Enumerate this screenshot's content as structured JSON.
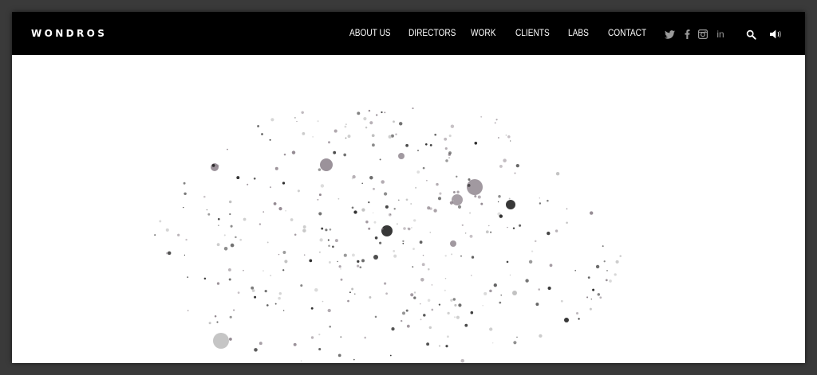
{
  "brand": {
    "name": "WONDROS"
  },
  "nav": {
    "items": [
      {
        "label": "ABOUT US"
      },
      {
        "label": "DIRECTORS"
      },
      {
        "label": "WORK"
      },
      {
        "label": "CLIENTS"
      },
      {
        "label": "LABS"
      },
      {
        "label": "CONTACT"
      }
    ]
  },
  "social": {
    "icons": [
      "twitter-icon",
      "facebook-icon",
      "instagram-icon",
      "linkedin-icon"
    ],
    "linkedin_text": "in"
  },
  "tools": {
    "icons": [
      "search-icon",
      "speaker-icon"
    ]
  },
  "colors": {
    "navbar_bg": "#000000",
    "nav_text": "#ffffff",
    "social_icon": "#9a9a9a",
    "canvas_bg": "#ffffff",
    "particle_dark": "#222222",
    "particle_mid": "#8a7f88",
    "particle_light": "#bbbbbb"
  }
}
